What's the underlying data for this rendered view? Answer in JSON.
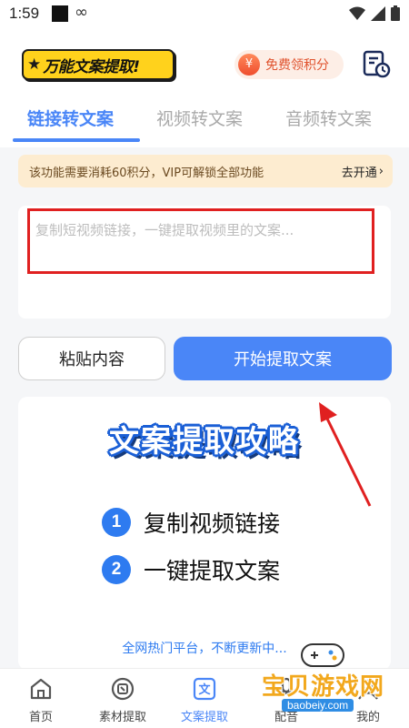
{
  "status_bar": {
    "time": "1:59"
  },
  "header": {
    "logo_text": "万能文案提取!",
    "points_button_label": "免费领积分",
    "icon_colors": {
      "accent": "#4a86f7",
      "warning": "#e02020"
    }
  },
  "tabs": [
    {
      "label": "链接转文案",
      "active": true
    },
    {
      "label": "视频转文案",
      "active": false
    },
    {
      "label": "音频转文案",
      "active": false
    }
  ],
  "vip_banner": {
    "text": "该功能需要消耗60积分，VIP可解锁全部功能",
    "link_label": "去开通",
    "chevron": "›"
  },
  "link_input": {
    "value": "",
    "placeholder": "复制短视频链接，一键提取视频里的文案..."
  },
  "actions": {
    "paste_label": "粘贴内容",
    "start_label": "开始提取文案"
  },
  "guide": {
    "title": "文案提取攻略",
    "steps": [
      {
        "num": "1",
        "text": "复制视频链接"
      },
      {
        "num": "2",
        "text": "一键提取文案"
      }
    ],
    "footer": "全网热门平台，不断更新中..."
  },
  "bottom_nav": [
    {
      "label": "首页",
      "icon": "home-icon",
      "active": false
    },
    {
      "label": "素材提取",
      "icon": "material-icon",
      "active": false
    },
    {
      "label": "文案提取",
      "icon": "text-icon",
      "active": true
    },
    {
      "label": "配音",
      "icon": "dubbing-icon",
      "active": false
    },
    {
      "label": "我的",
      "icon": "profile-icon",
      "active": false
    }
  ],
  "watermark": {
    "text": "宝贝游戏网",
    "url": "baobeiy.com"
  }
}
